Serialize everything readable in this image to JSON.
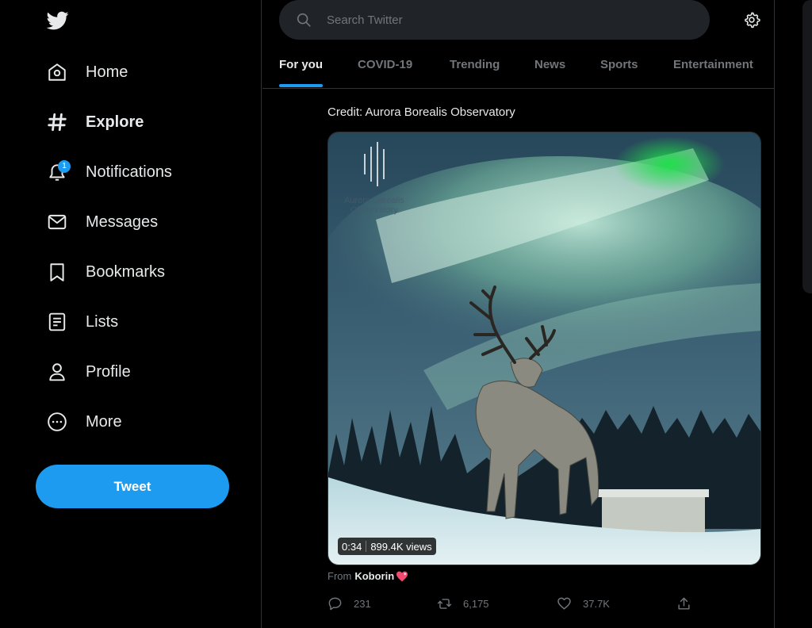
{
  "sidebar": {
    "items": [
      {
        "label": "Home",
        "icon": "home-icon"
      },
      {
        "label": "Explore",
        "icon": "hashtag-icon"
      },
      {
        "label": "Notifications",
        "icon": "bell-icon",
        "badge": "1"
      },
      {
        "label": "Messages",
        "icon": "envelope-icon"
      },
      {
        "label": "Bookmarks",
        "icon": "bookmark-icon"
      },
      {
        "label": "Lists",
        "icon": "list-icon"
      },
      {
        "label": "Profile",
        "icon": "person-icon"
      },
      {
        "label": "More",
        "icon": "more-circle-icon"
      }
    ],
    "tweet_button": "Tweet"
  },
  "search": {
    "placeholder": "Search Twitter"
  },
  "tabs": [
    {
      "label": "For you"
    },
    {
      "label": "COVID-19"
    },
    {
      "label": "Trending"
    },
    {
      "label": "News"
    },
    {
      "label": "Sports"
    },
    {
      "label": "Entertainment"
    }
  ],
  "post": {
    "credit": "Credit: Aurora Borealis Observatory",
    "watermark": "Aurora Borealis Observatory",
    "video": {
      "duration": "0:34",
      "views": "899.4K views"
    },
    "from_prefix": "From",
    "from_user": "Koborin",
    "actions": {
      "replies": "231",
      "retweets": "6,175",
      "likes": "37.7K"
    }
  },
  "colors": {
    "accent": "#1d9bf0",
    "background": "#000000",
    "muted": "#71767b"
  }
}
